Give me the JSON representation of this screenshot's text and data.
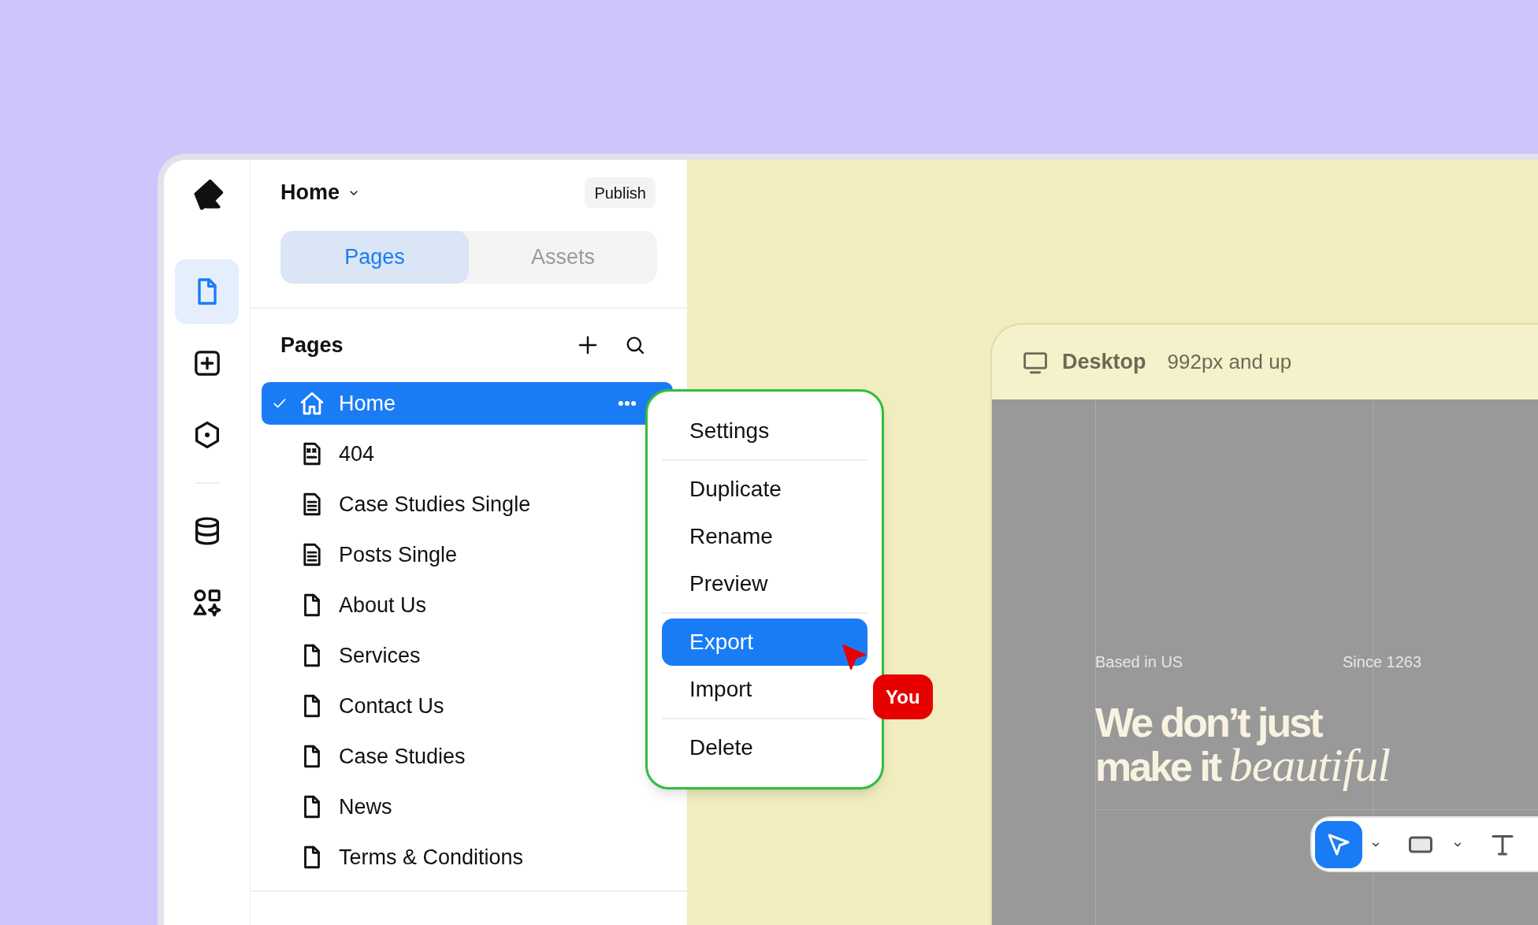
{
  "rail": {
    "items": [
      {
        "kind": "pages",
        "selected": true
      },
      {
        "kind": "add",
        "selected": false
      },
      {
        "kind": "components",
        "selected": false
      },
      {
        "kind": "divider"
      },
      {
        "kind": "database",
        "selected": false
      },
      {
        "kind": "assets",
        "selected": false
      }
    ]
  },
  "panel": {
    "title": "Home",
    "publish": "Publish",
    "tabs": [
      {
        "label": "Pages",
        "selected": true
      },
      {
        "label": "Assets",
        "selected": false
      }
    ],
    "section_title": "Pages",
    "pages": [
      {
        "label": "Home",
        "kind": "home",
        "selected": true
      },
      {
        "label": "404",
        "kind": "error",
        "selected": false
      },
      {
        "label": "Case Studies Single",
        "kind": "template",
        "selected": false
      },
      {
        "label": "Posts Single",
        "kind": "template",
        "selected": false
      },
      {
        "label": "About Us",
        "kind": "page",
        "selected": false
      },
      {
        "label": "Services",
        "kind": "page",
        "selected": false
      },
      {
        "label": "Contact Us",
        "kind": "page",
        "selected": false
      },
      {
        "label": "Case Studies",
        "kind": "page",
        "selected": false
      },
      {
        "label": "News",
        "kind": "page",
        "selected": false
      },
      {
        "label": "Terms & Conditions",
        "kind": "page",
        "selected": false
      }
    ]
  },
  "context_menu": {
    "groups": [
      [
        {
          "label": "Settings",
          "selected": false
        }
      ],
      [
        {
          "label": "Duplicate",
          "selected": false
        },
        {
          "label": "Rename",
          "selected": false
        },
        {
          "label": "Preview",
          "selected": false
        }
      ],
      [
        {
          "label": "Export",
          "selected": true
        },
        {
          "label": "Import",
          "selected": false
        }
      ],
      [
        {
          "label": "Delete",
          "selected": false
        }
      ]
    ]
  },
  "cursor_badge": "You",
  "canvas": {
    "breakpoint": {
      "name": "Desktop",
      "range": "992px and up"
    },
    "site": {
      "left_label": "Based in US",
      "right_label": "Since 1263",
      "headline_lines": [
        "We don’t just",
        "make it *beautiful*"
      ]
    },
    "toolbar": {
      "tools": [
        {
          "kind": "select",
          "selected": true
        },
        {
          "kind": "rectangle",
          "selected": false
        },
        {
          "kind": "text",
          "selected": false
        }
      ]
    }
  }
}
